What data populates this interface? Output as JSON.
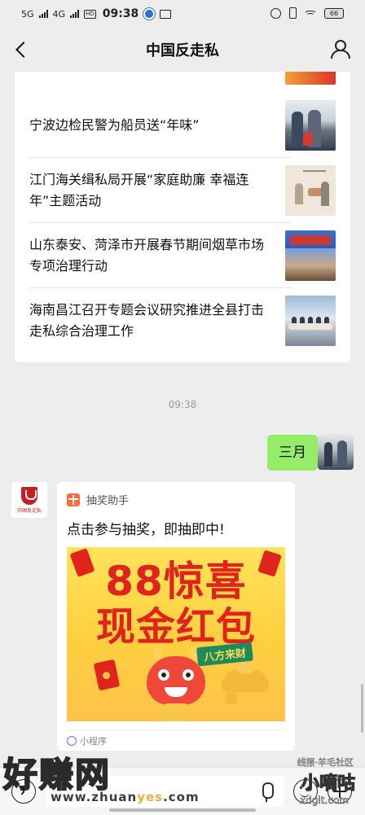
{
  "status_bar": {
    "network1": "5G",
    "network2": "4G",
    "hd": "HD",
    "time": "09:38",
    "battery": "66"
  },
  "header": {
    "title": "中国反走私"
  },
  "news": [
    {
      "title": "宁波边检民警为船员送“年味”"
    },
    {
      "title": "江门海关缉私局开展“家庭助廉 幸福连年”主题活动"
    },
    {
      "title": "山东泰安、菏泽市开展春节期间烟草市场专项治理行动"
    },
    {
      "title": "海南昌江召开专题会议研究推进全县打击走私综合治理工作"
    }
  ],
  "chat": {
    "timestamp": "09:38",
    "outgoing_text": "三月",
    "left_avatar_text": "中国反走私"
  },
  "mini_program": {
    "app_name": "抽奖助手",
    "title": "点击参与抽奖，即抽即中!",
    "banner_line1": "88惊喜",
    "banner_line2": "现金红包",
    "banner_tag": "八方来财",
    "footer_label": "小程序"
  },
  "watermarks": {
    "left_main": "好赚网",
    "left_sub_a": "www.zhuan",
    "left_sub_b": "yes",
    "left_sub_c": ".com",
    "right_top": "线报·羊毛社区",
    "right_main": "小嘀咕",
    "right_sub": "xdgit.com"
  },
  "colors": {
    "bubble_green": "#95ec69",
    "banner_red": "#e0231d",
    "banner_yellow": "#ffd545"
  }
}
